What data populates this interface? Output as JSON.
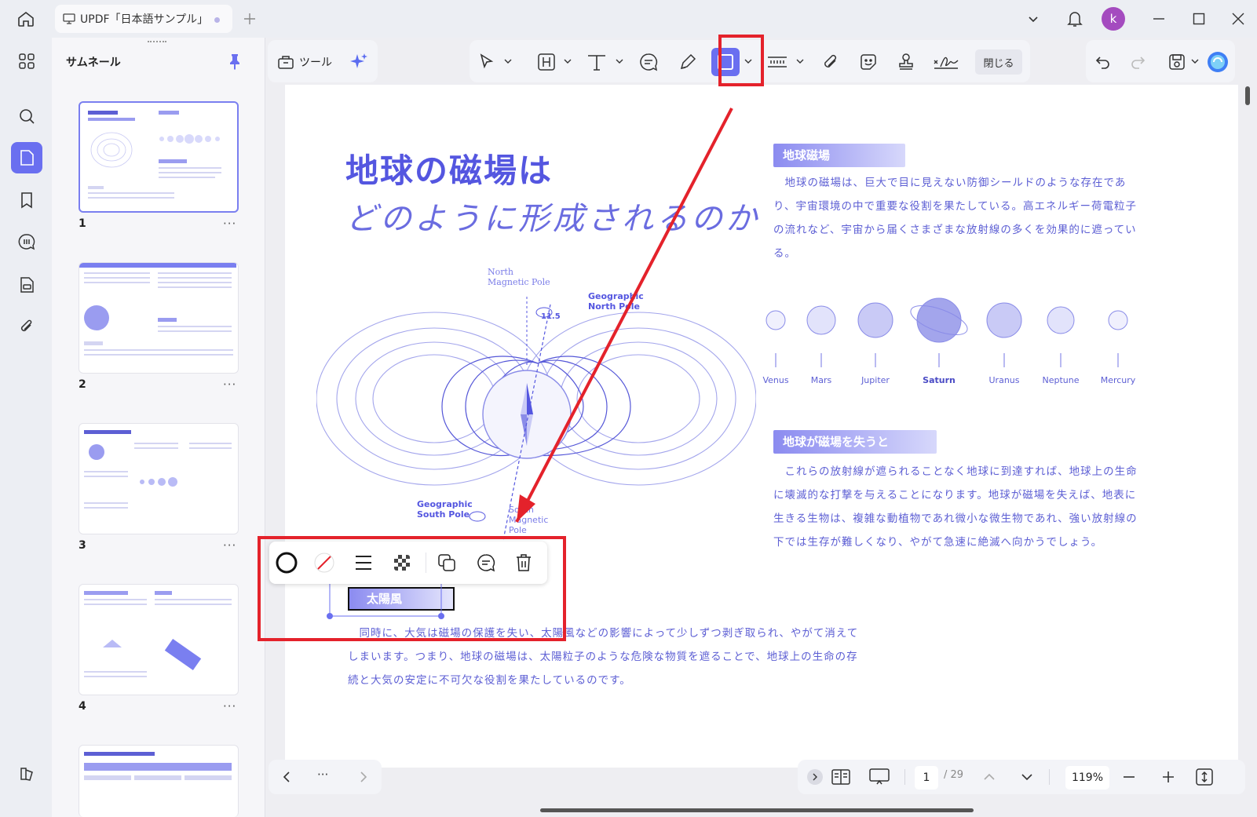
{
  "titlebar": {
    "tab_title": "UPDF「日本語サンプル」",
    "avatar_letter": "k"
  },
  "sidebar": {
    "title": "サムネール",
    "thumbnails": [
      {
        "number": "1",
        "more": "···"
      },
      {
        "number": "2",
        "more": "···"
      },
      {
        "number": "3",
        "more": "···"
      },
      {
        "number": "4",
        "more": "···"
      }
    ]
  },
  "toolbar": {
    "tools_label": "ツール",
    "close_label": "閉じる"
  },
  "document": {
    "title_line1": "地球の磁場は",
    "title_line2": "どのように形成されるのか",
    "section1_heading": "地球磁場",
    "section1_body": "　地球の磁場は、巨大で目に見えない防御シールドのような存在であり、宇宙環境の中で重要な役割を果たしている。高エネルギー荷電粒子の流れなど、宇宙から届くさまざまな放射線の多くを効果的に遮っている。",
    "planets": [
      "Venus",
      "Mars",
      "Jupiter",
      "Saturn",
      "Uranus",
      "Neptune",
      "Mercury"
    ],
    "diagram_labels": {
      "north_magnetic": "North\nMagnetic Pole",
      "geographic_north": "Geographic\nNorth Pole",
      "angle": "11.5",
      "geographic_south": "Geographic\nSouth Pole",
      "south_magnetic": "South\nMagnetic\nPole"
    },
    "section2_heading": "地球が磁場を失うと",
    "section2_body": "　これらの放射線が遮られることなく地球に到達すれば、地球上の生命に壊滅的な打撃を与えることになります。地球が磁場を失えば、地表に生きる生物は、複雑な動植物であれ微小な微生物であれ、強い放射線の下では生存が難しくなり、やがて急速に絶滅へ向かうでしょう。",
    "selected_box_label": "太陽風",
    "section3_body": "　同時に、大気は磁場の保護を失い、太陽風などの影響によって少しずつ剥ぎ取られ、やがて消えてしまいます。つまり、地球の磁場は、太陽粒子のような危険な物質を遮ることで、地球上の生命の存続と大気の安定に不可欠な役割を果たしているのです。"
  },
  "bottombar": {
    "more": "···",
    "page_current": "1",
    "page_total": "/ 29",
    "zoom": "119%"
  },
  "colors": {
    "accent": "#6a6ff0",
    "annotation_red": "#e4222b",
    "doc_text": "#5d5fd4"
  }
}
